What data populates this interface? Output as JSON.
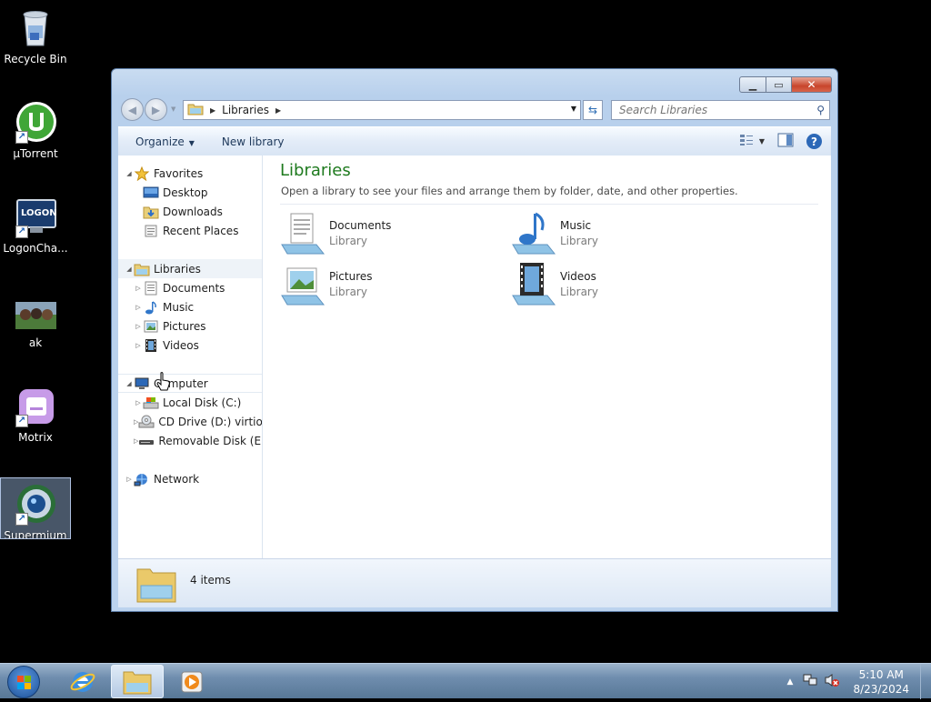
{
  "desktop": {
    "icons": [
      {
        "label": "Recycle Bin"
      },
      {
        "label": "µTorrent"
      },
      {
        "label": "LogonCha..."
      },
      {
        "label": "ak"
      },
      {
        "label": "Motrix"
      },
      {
        "label": "Supermium"
      }
    ],
    "logon_badge": "LOGON"
  },
  "window": {
    "address": {
      "crumb": "Libraries"
    },
    "search": {
      "placeholder": "Search Libraries"
    },
    "toolbar": {
      "organize": "Organize",
      "new_library": "New library"
    },
    "nav": {
      "favorites": {
        "label": "Favorites",
        "items": [
          "Desktop",
          "Downloads",
          "Recent Places"
        ]
      },
      "libraries": {
        "label": "Libraries",
        "items": [
          "Documents",
          "Music",
          "Pictures",
          "Videos"
        ]
      },
      "computer": {
        "label": "Computer",
        "items": [
          "Local Disk (C:)",
          "CD Drive (D:) virtio-win",
          "Removable Disk (E:)"
        ]
      },
      "network": {
        "label": "Network"
      }
    },
    "content": {
      "title": "Libraries",
      "subtitle": "Open a library to see your files and arrange them by folder, date, and other properties.",
      "libraries": [
        {
          "name": "Documents",
          "kind": "Library"
        },
        {
          "name": "Music",
          "kind": "Library"
        },
        {
          "name": "Pictures",
          "kind": "Library"
        },
        {
          "name": "Videos",
          "kind": "Library"
        }
      ]
    },
    "details": {
      "count": "4 items"
    }
  },
  "taskbar": {
    "time": "5:10 AM",
    "date": "8/23/2024"
  }
}
